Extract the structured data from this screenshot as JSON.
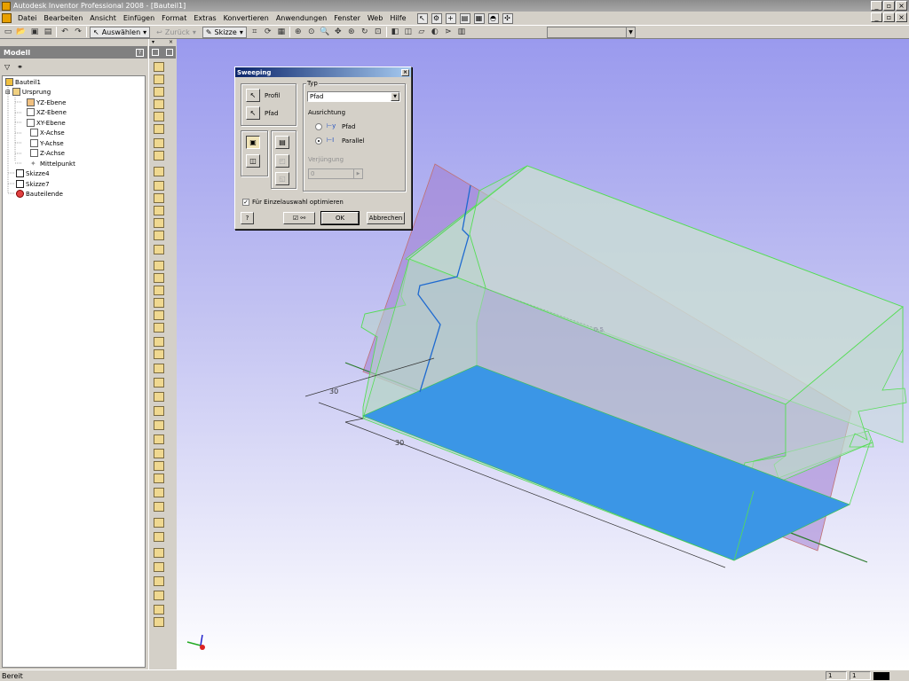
{
  "window": {
    "title": "Autodesk Inventor Professional 2008 - [Bauteil1]"
  },
  "menu": {
    "items": [
      "Datei",
      "Bearbeiten",
      "Ansicht",
      "Einfügen",
      "Format",
      "Extras",
      "Konvertieren",
      "Anwendungen",
      "Fenster",
      "Web",
      "Hilfe"
    ]
  },
  "toolbar": {
    "select_label": "Auswählen",
    "return_label": "Zurück",
    "sketch_label": "Skizze"
  },
  "browser": {
    "title": "Modell",
    "tree": [
      "Bauteil1",
      "Ursprung",
      "YZ-Ebene",
      "XZ-Ebene",
      "XY-Ebene",
      "X-Achse",
      "Y-Achse",
      "Z-Achse",
      "Mittelpunkt",
      "Skizze4",
      "Skizze7",
      "Bauteilende"
    ]
  },
  "dialog": {
    "title": "Sweeping",
    "profile_label": "Profil",
    "path_label": "Pfad",
    "type_group": "Typ",
    "type_value": "Pfad",
    "orientation_label": "Ausrichtung",
    "orient_path": "Pfad",
    "orient_parallel": "Parallel",
    "taper_label": "Verjüngung",
    "taper_value": "0",
    "optimize_label": "Für Einzelauswahl optimieren",
    "ok_label": "OK",
    "cancel_label": "Abbrechen",
    "help_label": "?"
  },
  "viewport": {
    "dim_30_a": "30",
    "dim_30_b": "30",
    "dim_0_5": "0,5"
  },
  "status": {
    "text": "Bereit",
    "field1": "1",
    "field2": "1"
  }
}
